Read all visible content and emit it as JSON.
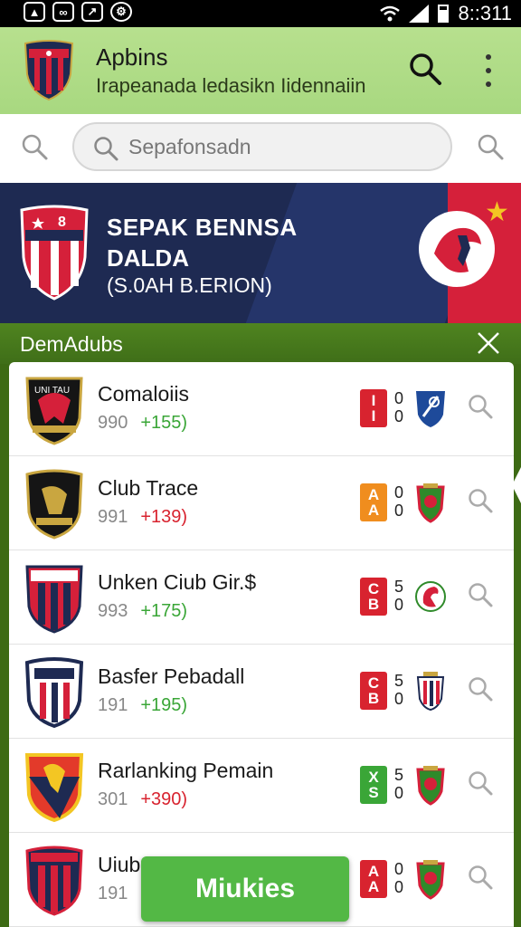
{
  "status_bar": {
    "time": "8::311"
  },
  "app_bar": {
    "title": "Apbins",
    "subtitle": "Irapeanada ledasikn Iidennaiin"
  },
  "search": {
    "placeholder": "Sepafonsadn"
  },
  "banner": {
    "line1": "SEPAK BENNSA",
    "line2": "DALDA",
    "line3": "(S.0AH B.ERION)",
    "shield_text": "8",
    "colors": {
      "navy": "#1e2a52",
      "red": "#d5203a",
      "star": "#f3c623"
    }
  },
  "section": {
    "title": "DemAdubs"
  },
  "clubs": [
    {
      "name": "Comaloiis",
      "count": "990",
      "change": "+155)",
      "change_color": "#3aa637",
      "badge": [
        "I",
        "I"
      ],
      "badge_color": "#d8232f",
      "score": [
        "0",
        "0"
      ],
      "team_icon": "blue-shield-icon"
    },
    {
      "name": "Club Trace",
      "count": "991",
      "change": "+139)",
      "change_color": "#d8232f",
      "badge": [
        "A",
        "A"
      ],
      "badge_color": "#f08d1e",
      "score": [
        "0",
        "0"
      ],
      "team_icon": "green-red-crest-icon"
    },
    {
      "name": "Unken Ciub Gir.$",
      "count": "993",
      "change": "+175)",
      "change_color": "#3aa637",
      "badge": [
        "C",
        "B"
      ],
      "badge_color": "#d8232f",
      "score": [
        "5",
        "0"
      ],
      "team_icon": "red-rooster-icon"
    },
    {
      "name": "Basfer Pebadall",
      "count": "191",
      "change": "+195)",
      "change_color": "#3aa637",
      "badge": [
        "C",
        "B"
      ],
      "badge_color": "#d8232f",
      "score": [
        "5",
        "0"
      ],
      "team_icon": "striped-crest-icon"
    },
    {
      "name": "Rarlanking Pemain",
      "count": "301",
      "change": "+390)",
      "change_color": "#d8232f",
      "badge": [
        "X",
        "S"
      ],
      "badge_color": "#3aa637",
      "score": [
        "5",
        "0"
      ],
      "team_icon": "green-red-crest-icon"
    },
    {
      "name": "Uiub",
      "count": "191",
      "change": "",
      "change_color": "#3aa637",
      "badge": [
        "A",
        "A"
      ],
      "badge_color": "#d8232f",
      "score": [
        "0",
        "0"
      ],
      "team_icon": "green-red-crest-icon"
    }
  ],
  "fab": {
    "label": "Miukies"
  }
}
